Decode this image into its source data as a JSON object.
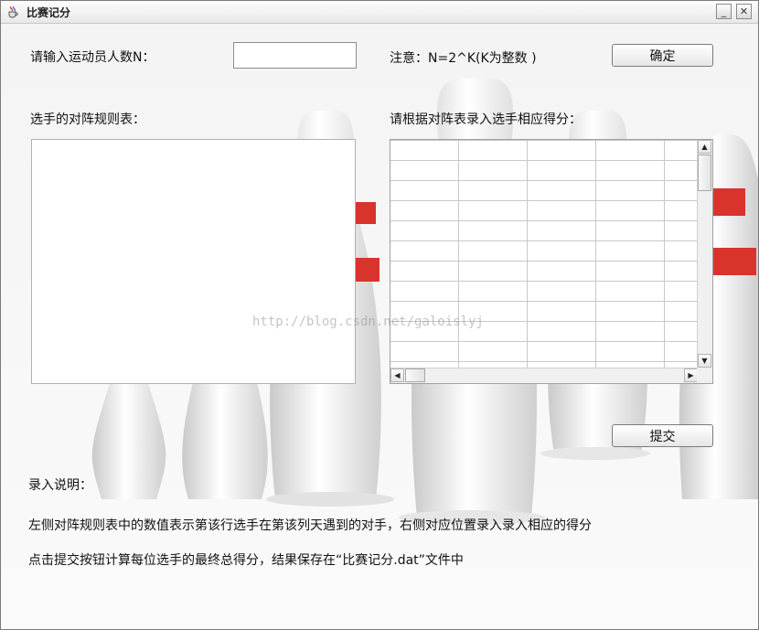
{
  "window": {
    "title": "比赛记分",
    "minimize_glyph": "_",
    "close_glyph": "✕",
    "app_icon": "java-cup-icon"
  },
  "form": {
    "n_label": "请输入运动员人数N：",
    "n_value": "",
    "note_label": "注意：N=2^K(K为整数 )",
    "confirm_button": "确定",
    "schedule_label": "选手的对阵规则表：",
    "schedule_value": "",
    "score_label": "请根据对阵表录入选手相应得分：",
    "submit_button": "提交"
  },
  "instructions": {
    "heading": "录入说明：",
    "line1": "左侧对阵规则表中的数值表示第该行选手在第该列天遇到的对手，右侧对应位置录入录入相应的得分",
    "line2": "点击提交按钮计算每位选手的最终总得分，结果保存在“比赛记分.dat”文件中"
  },
  "score_table": {
    "visible_rows": 11,
    "visible_columns": 5,
    "scrollbar_up_glyph": "▲",
    "scrollbar_down_glyph": "▼",
    "scrollbar_left_glyph": "◀",
    "scrollbar_right_glyph": "▶"
  },
  "watermark": "http://blog.csdn.net/galoislyj",
  "colors": {
    "pin_stripe": "#d9342b",
    "window_bg": "#f4f4f4"
  }
}
